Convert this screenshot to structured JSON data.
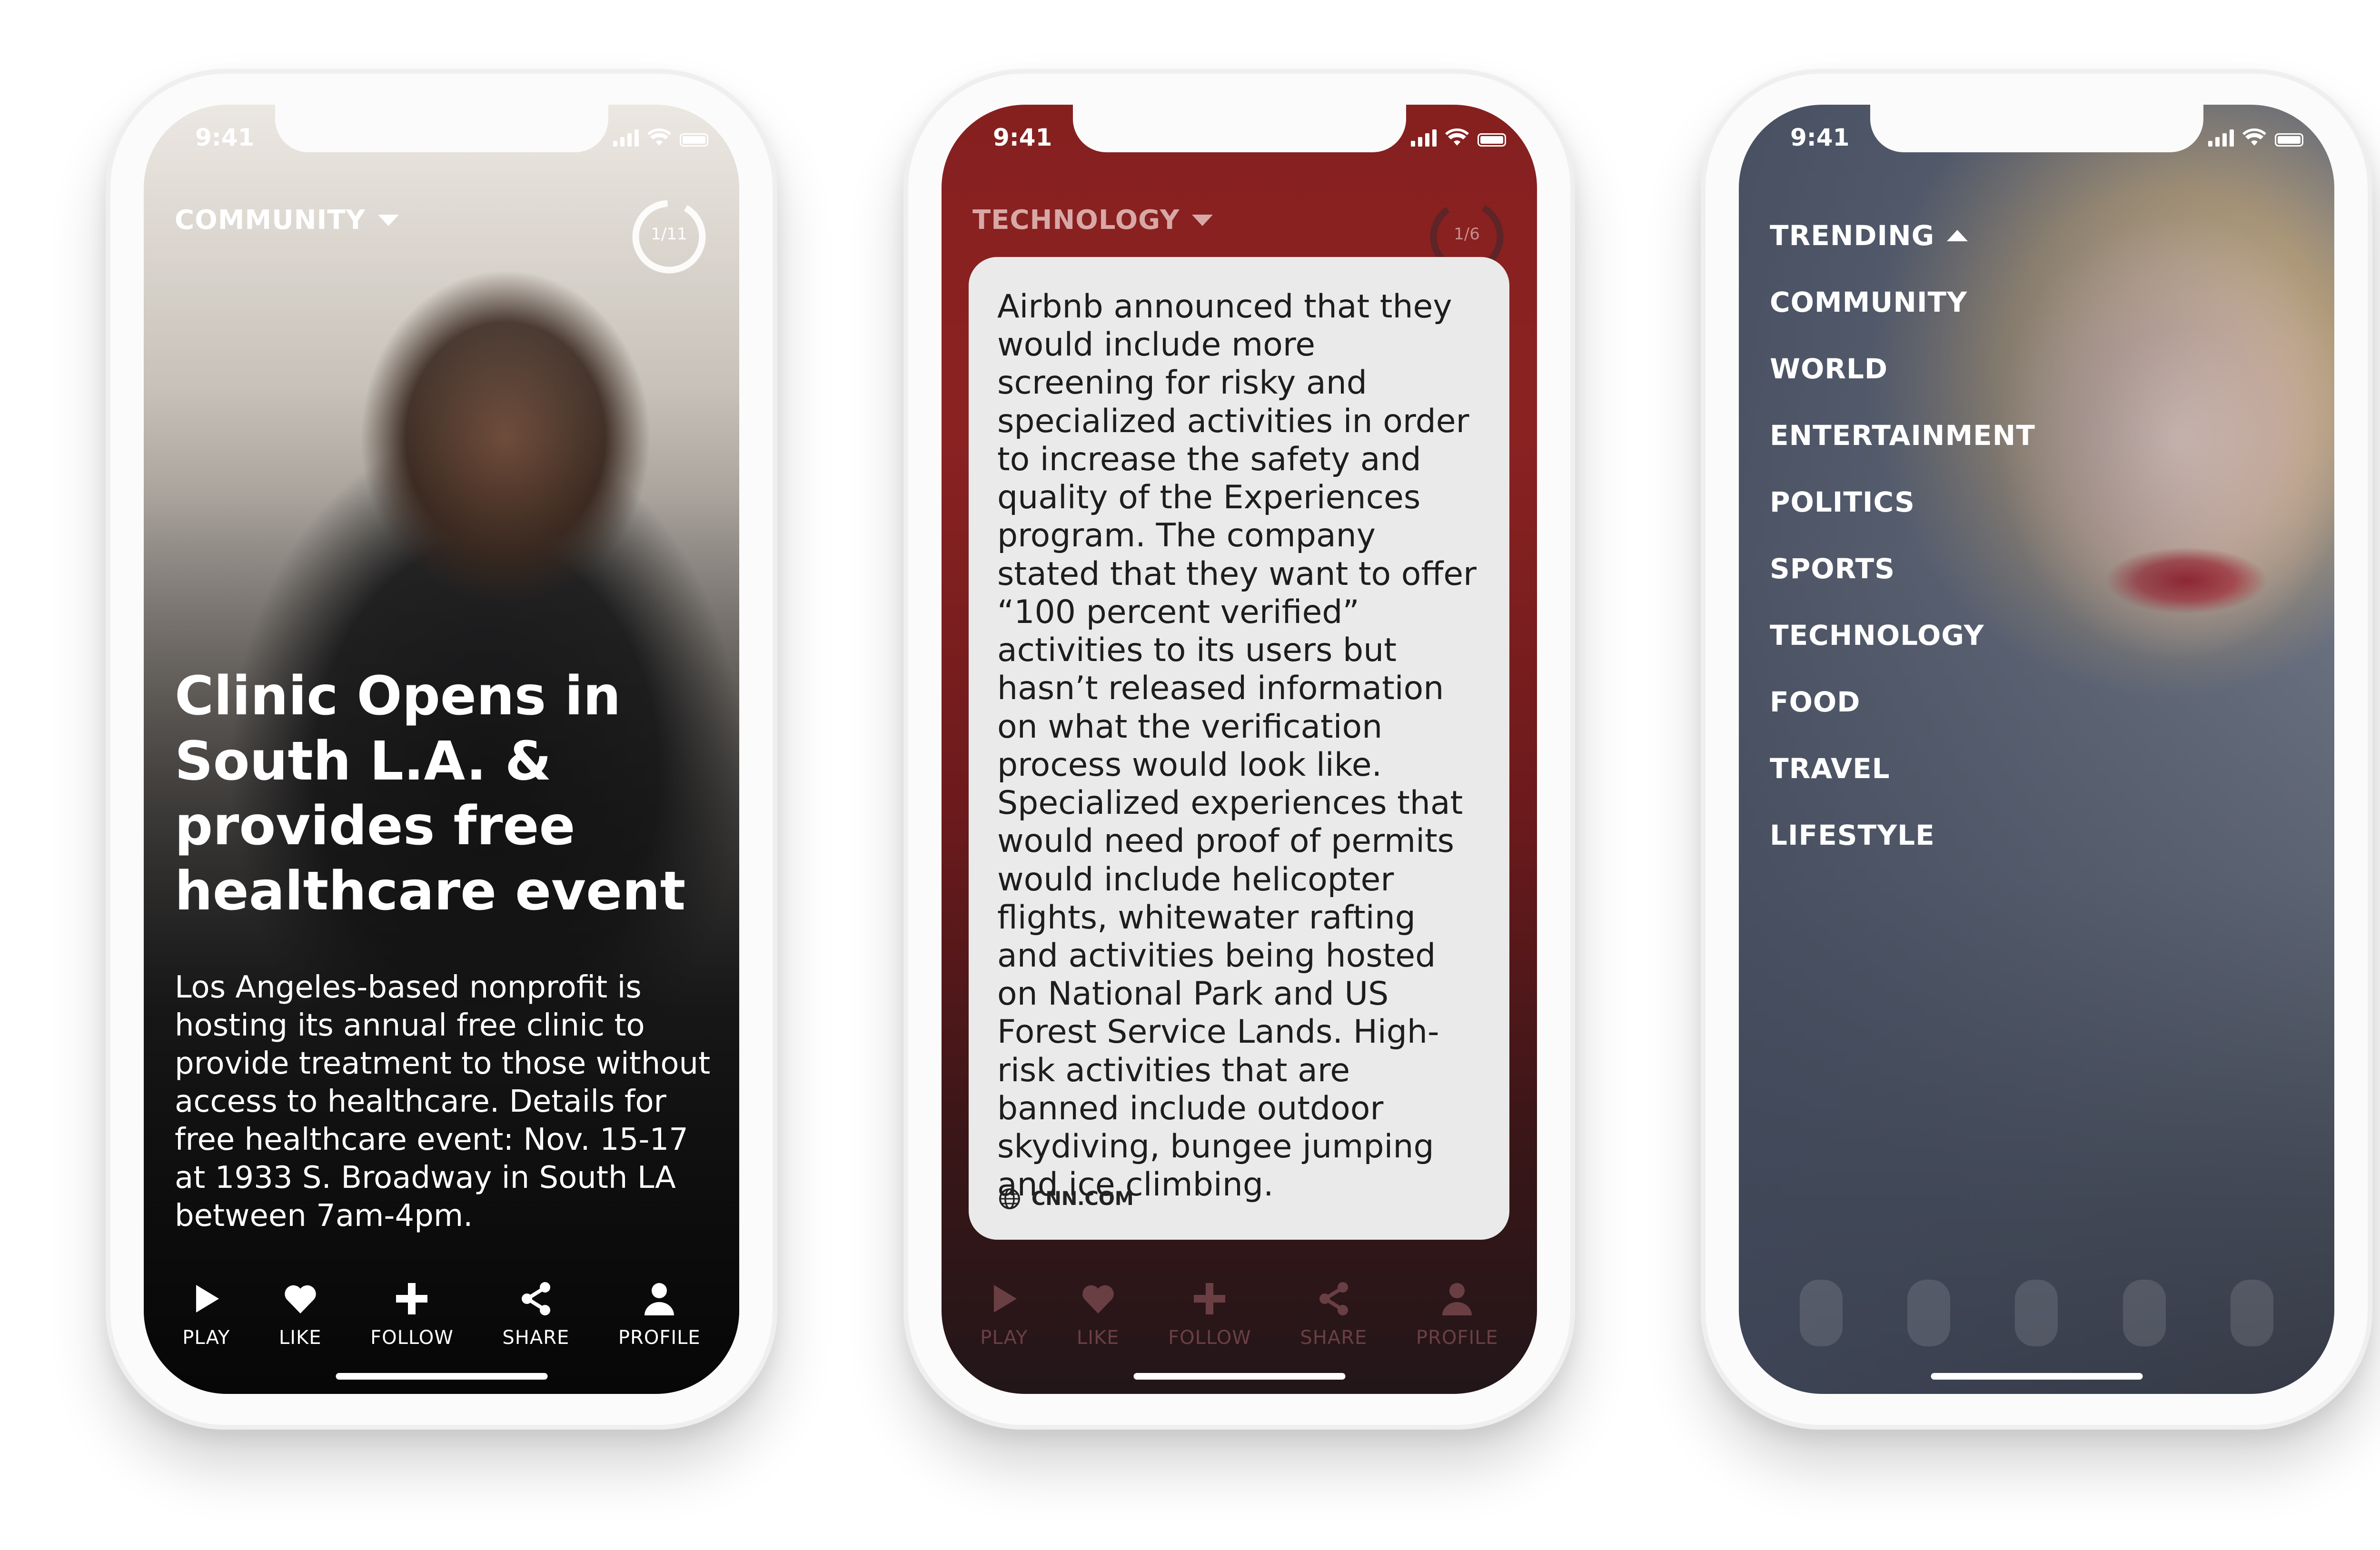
{
  "status_time": "9:41",
  "phone1": {
    "category": "COMMUNITY",
    "counter": "1/11",
    "headline": "Clinic Opens in South L.A. & provides free healthcare event",
    "body": "Los Angeles-based nonprofit is hosting its annual free clinic to provide treatment to those without access to healthcare. Details for free healthcare event: Nov. 15-17 at 1933 S. Broadway in South LA between 7am-4pm.",
    "counter_progress": 0.09
  },
  "phone2": {
    "category": "TECHNOLOGY",
    "counter": "1/6",
    "article": "Airbnb announced that they would include more screening for risky and specialized activities in order to increase the safety and quality of the Experiences program. The company stated that they want to offer “100 percent verified” activities to its users but hasn’t released information on what the verification process would look like. Specialized experiences that would need proof of permits would include helicopter flights, whitewater rafting and activities being hosted on National Park and US Forest Service Lands. High-risk activities that are banned include outdoor skydiving, bungee jumping and ice climbing.",
    "source": "CNN.COM",
    "counter_progress": 0.17
  },
  "phone3": {
    "menu": [
      "TRENDING",
      "COMMUNITY",
      "WORLD",
      "ENTERTAINMENT",
      "POLITICS",
      "SPORTS",
      "TECHNOLOGY",
      "FOOD",
      "TRAVEL",
      "LIFESTYLE"
    ]
  },
  "nav": {
    "play": "PLAY",
    "like": "LIKE",
    "follow": "FOLLOW",
    "share": "SHARE",
    "profile": "PROFILE"
  },
  "colors": {
    "tech_red": "#8b2222",
    "menu_bg": "#5f6879",
    "card_bg": "#eaeaea"
  }
}
